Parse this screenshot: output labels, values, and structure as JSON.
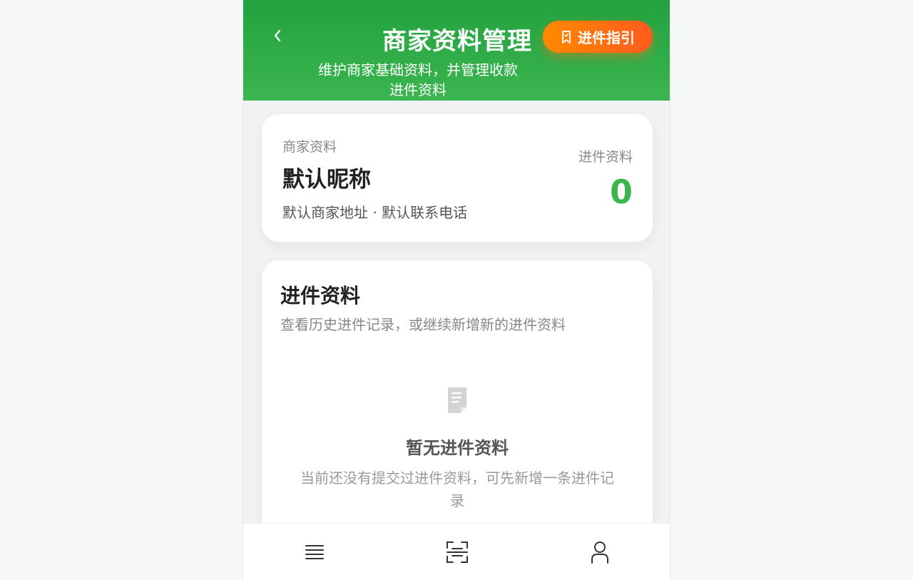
{
  "header": {
    "title": "商家资料管理",
    "subtitle": "维护商家基础资料，并管理收款进件资料",
    "guide_label": "进件指引",
    "back_icon": "chevron-left-icon",
    "guide_icon": "bookmark-icon"
  },
  "merchant": {
    "section_label": "商家资料",
    "name": "默认昵称",
    "address_line": "默认商家地址 · 默认联系电话",
    "count_label": "进件资料",
    "count": "0"
  },
  "records": {
    "title": "进件资料",
    "description": "查看历史进件记录，或继续新增新的进件资料",
    "empty_title": "暂无进件资料",
    "empty_desc": "当前还没有提交过进件资料，可先新增一条进件记录",
    "empty_icon": "document-icon"
  },
  "tabbar": {
    "items": [
      {
        "icon": "menu-list-icon"
      },
      {
        "icon": "scan-icon"
      },
      {
        "icon": "user-icon"
      }
    ]
  },
  "colors": {
    "header_green": "#22a23f",
    "accent_green": "#3cb54a",
    "guide_orange": "#ff7a10"
  }
}
